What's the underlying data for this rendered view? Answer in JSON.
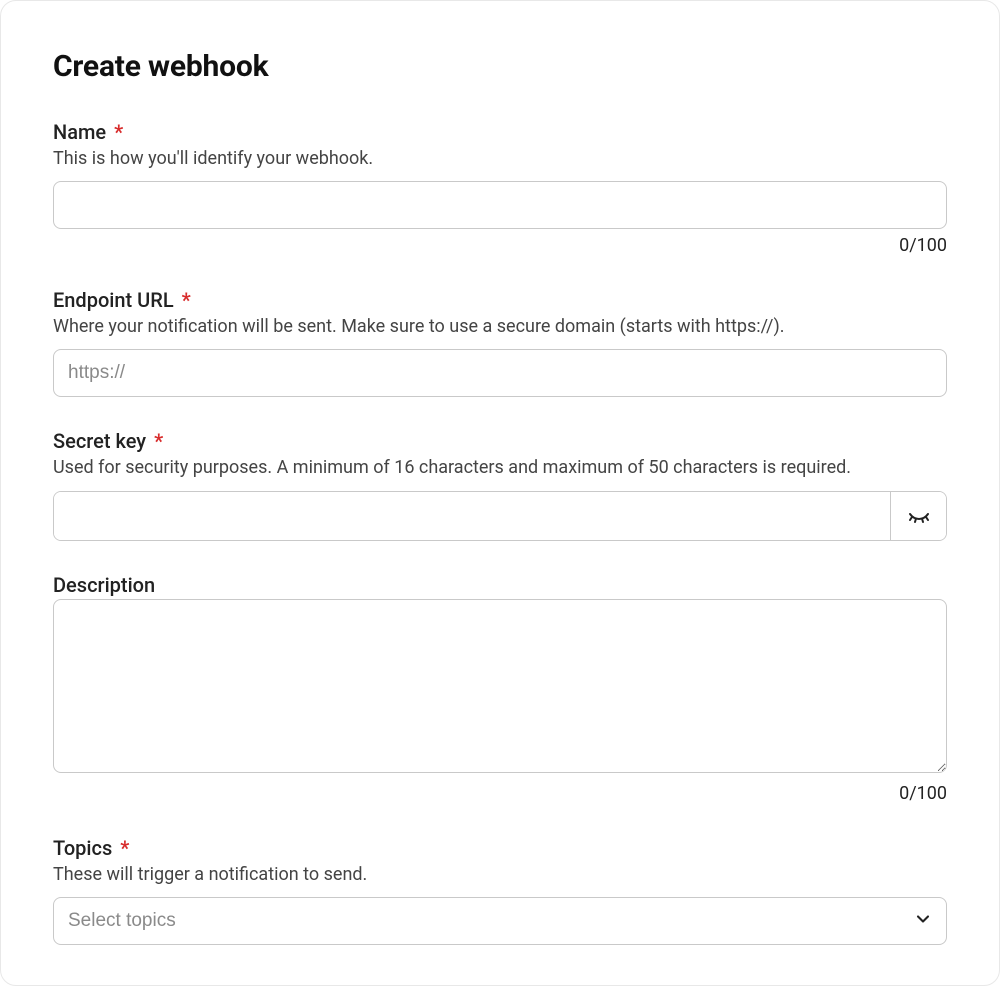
{
  "page": {
    "title": "Create webhook"
  },
  "fields": {
    "name": {
      "label": "Name",
      "required": true,
      "help": "This is how you'll identify your webhook.",
      "value": "",
      "counter": "0/100"
    },
    "endpoint": {
      "label": "Endpoint URL",
      "required": true,
      "help": "Where your notification will be sent. Make sure to use a secure domain (starts with https://).",
      "placeholder": "https://",
      "value": ""
    },
    "secret": {
      "label": "Secret key",
      "required": true,
      "help": "Used for security purposes. A minimum of 16 characters and maximum of 50 characters is required.",
      "value": ""
    },
    "description": {
      "label": "Description",
      "required": false,
      "value": "",
      "counter": "0/100"
    },
    "topics": {
      "label": "Topics",
      "required": true,
      "help": "These will trigger a notification to send.",
      "placeholder": "Select topics"
    }
  },
  "required_marker": "*"
}
